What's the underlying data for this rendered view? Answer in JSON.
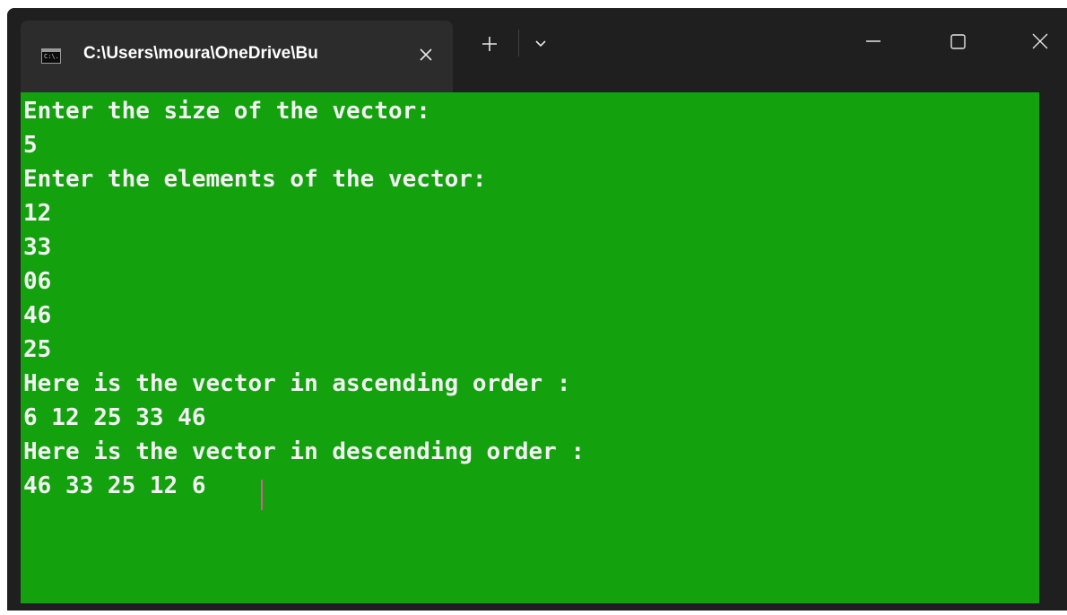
{
  "window": {
    "tab_title": "C:\\Users\\moura\\OneDrive\\Bu",
    "tab_icon_text": "C:\\.",
    "icons": {
      "tab_icon": "terminal-icon",
      "tab_close": "close-icon",
      "new_tab": "plus-icon",
      "dropdown": "chevron-down-icon",
      "minimize": "minimize-icon",
      "maximize": "maximize-icon",
      "close": "close-icon"
    }
  },
  "console": {
    "background": "#13a10e",
    "text_color": "#f2f2f2",
    "lines": [
      "Enter the size of the vector:",
      "5",
      "Enter the elements of the vector:",
      "12",
      "33",
      "06",
      "46",
      "25",
      "Here is the vector in ascending order :",
      "6 12 25 33 46",
      "Here is the vector in descending order :",
      "46 33 25 12 6"
    ]
  }
}
